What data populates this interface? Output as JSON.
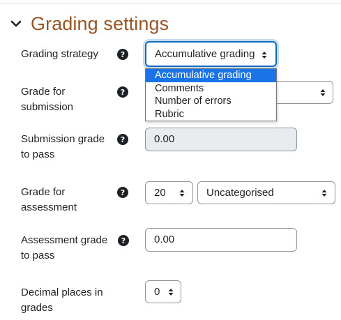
{
  "section": {
    "title": "Grading settings",
    "icon": "chevron-down-icon",
    "color": "#995524"
  },
  "fields": {
    "grading_strategy": {
      "label": "Grading strategy",
      "value": "Accumulative grading",
      "options": [
        "Accumulative grading",
        "Comments",
        "Number of errors",
        "Rubric"
      ],
      "selected_option": "Accumulative grading"
    },
    "grade_for_submission": {
      "label_line1": "Grade for",
      "label_line2": "submission"
    },
    "submission_grade_to_pass": {
      "label_line1": "Submission grade",
      "label_line2": "to pass",
      "value": "0.00"
    },
    "grade_for_assessment": {
      "label_line1": "Grade for",
      "label_line2": "assessment",
      "value": "20",
      "category": "Uncategorised"
    },
    "assessment_grade_to_pass": {
      "label_line1": "Assessment grade",
      "label_line2": "to pass",
      "value": "0.00"
    },
    "decimal_places": {
      "label_line1": "Decimal places in",
      "label_line2": "grades",
      "value": "0"
    }
  },
  "icons": {
    "help": "question-circle-icon",
    "select": "select-arrows-icon"
  },
  "colors": {
    "focus": "#0f6cbf",
    "highlight": "#1a73e8",
    "disabled_bg": "#e9ecef"
  }
}
